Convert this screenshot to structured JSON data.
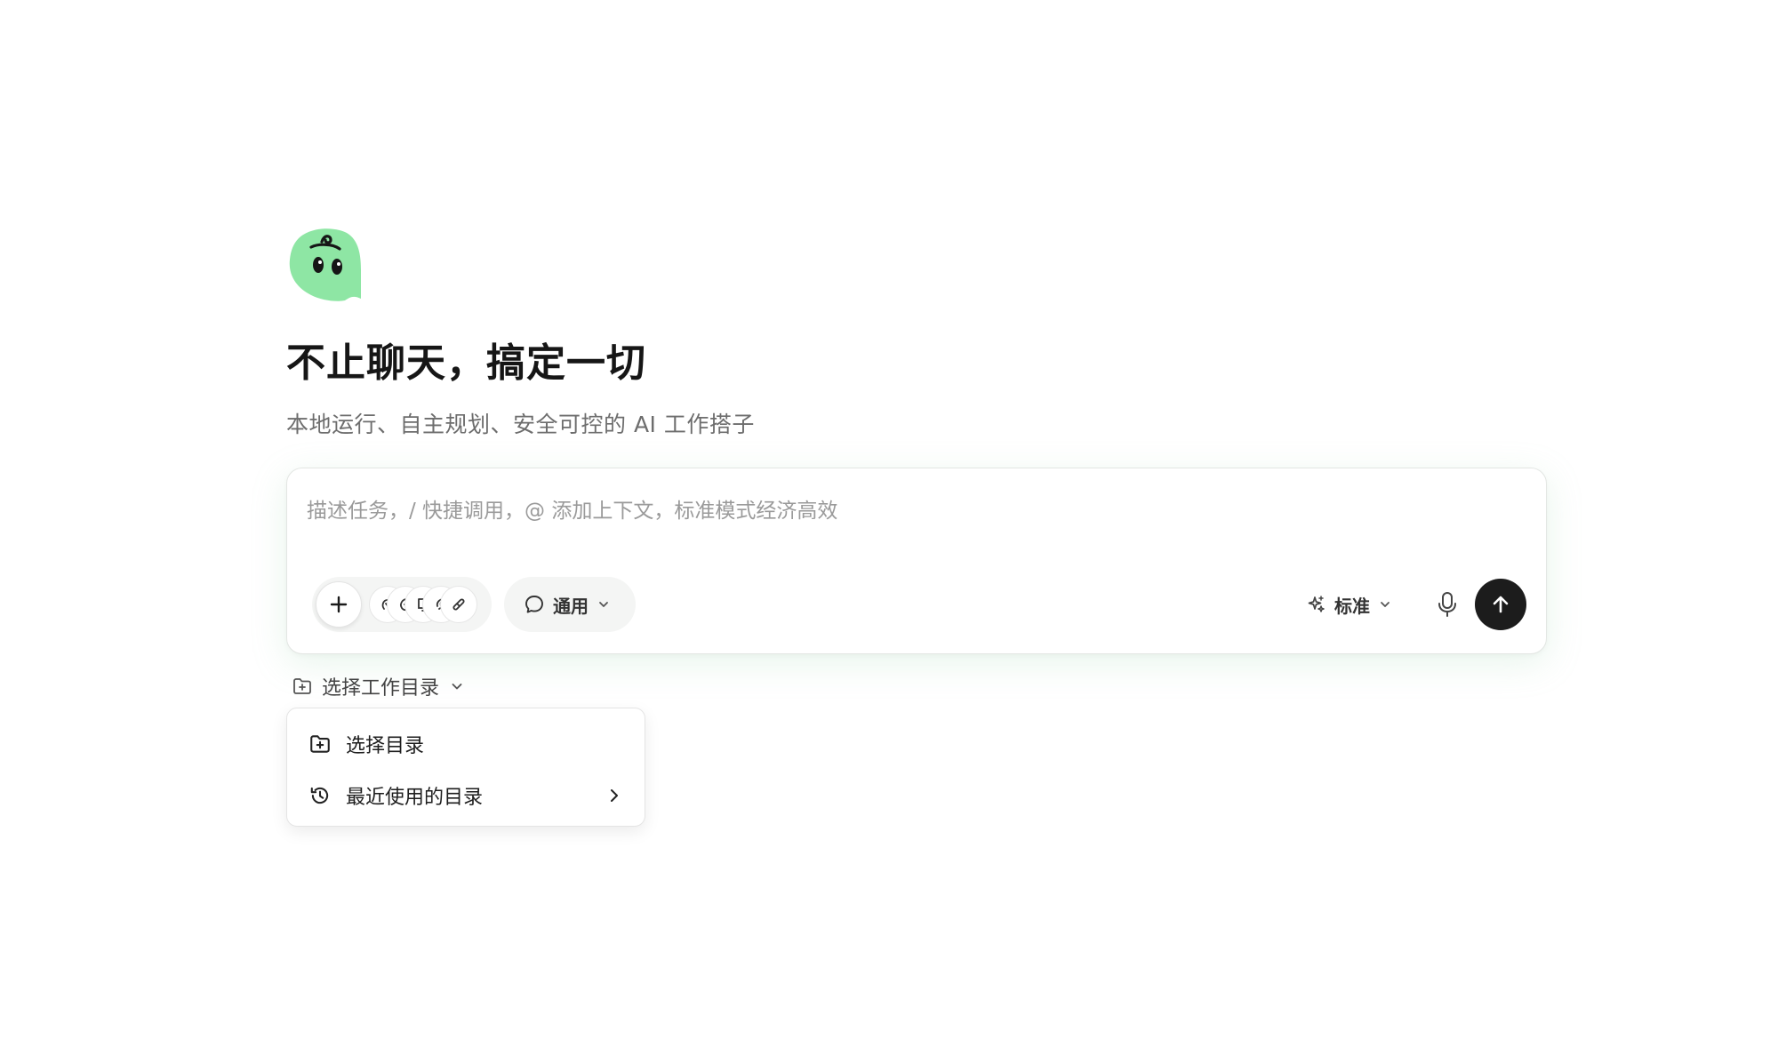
{
  "hero": {
    "title": "不止聊天，搞定一切",
    "subtitle": "本地运行、自主规划、安全可控的 AI 工作搭子"
  },
  "composer": {
    "placeholder": "描述任务，/ 快捷调用，@ 添加上下文，标准模式经济高效",
    "value": "",
    "mode_label": "通用",
    "quality_label": "标准"
  },
  "directory": {
    "trigger_label": "选择工作目录",
    "menu": [
      {
        "label": "选择目录",
        "icon": "folder-plus-icon"
      },
      {
        "label": "最近使用的目录",
        "icon": "history-icon",
        "has_submenu": true
      }
    ]
  },
  "icons": {
    "logo": "ghost-mascot-logo",
    "tools": [
      "tool-icon-1",
      "tool-icon-2",
      "tool-icon-3",
      "tool-icon-4",
      "tool-icon-5"
    ],
    "mode": "chat-bubble-icon",
    "quality": "sparkle-icon",
    "mic": "microphone-icon",
    "send": "arrow-up-icon"
  },
  "colors": {
    "brand_green": "#8ee6a4",
    "send_button": "#1c1c1c",
    "composer_glow": "#96d2aa"
  }
}
